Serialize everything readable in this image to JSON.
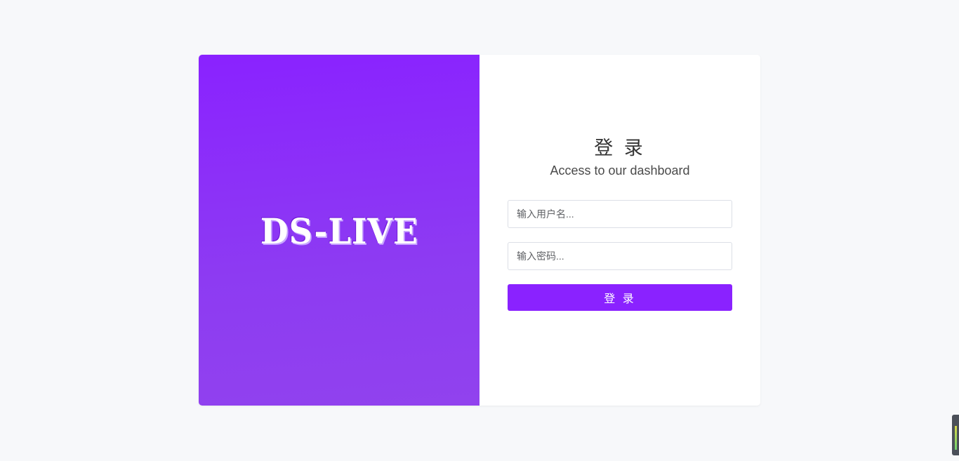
{
  "brand": {
    "logo_text": "DS-LIVE",
    "gradient_start": "#8a22ff",
    "gradient_end": "#9142ee"
  },
  "login_form": {
    "title": "登 录",
    "subtitle": "Access to our dashboard",
    "username_placeholder": "输入用户名...",
    "password_placeholder": "输入密码...",
    "submit_label": "登 录",
    "accent_color": "#8a22ff"
  }
}
